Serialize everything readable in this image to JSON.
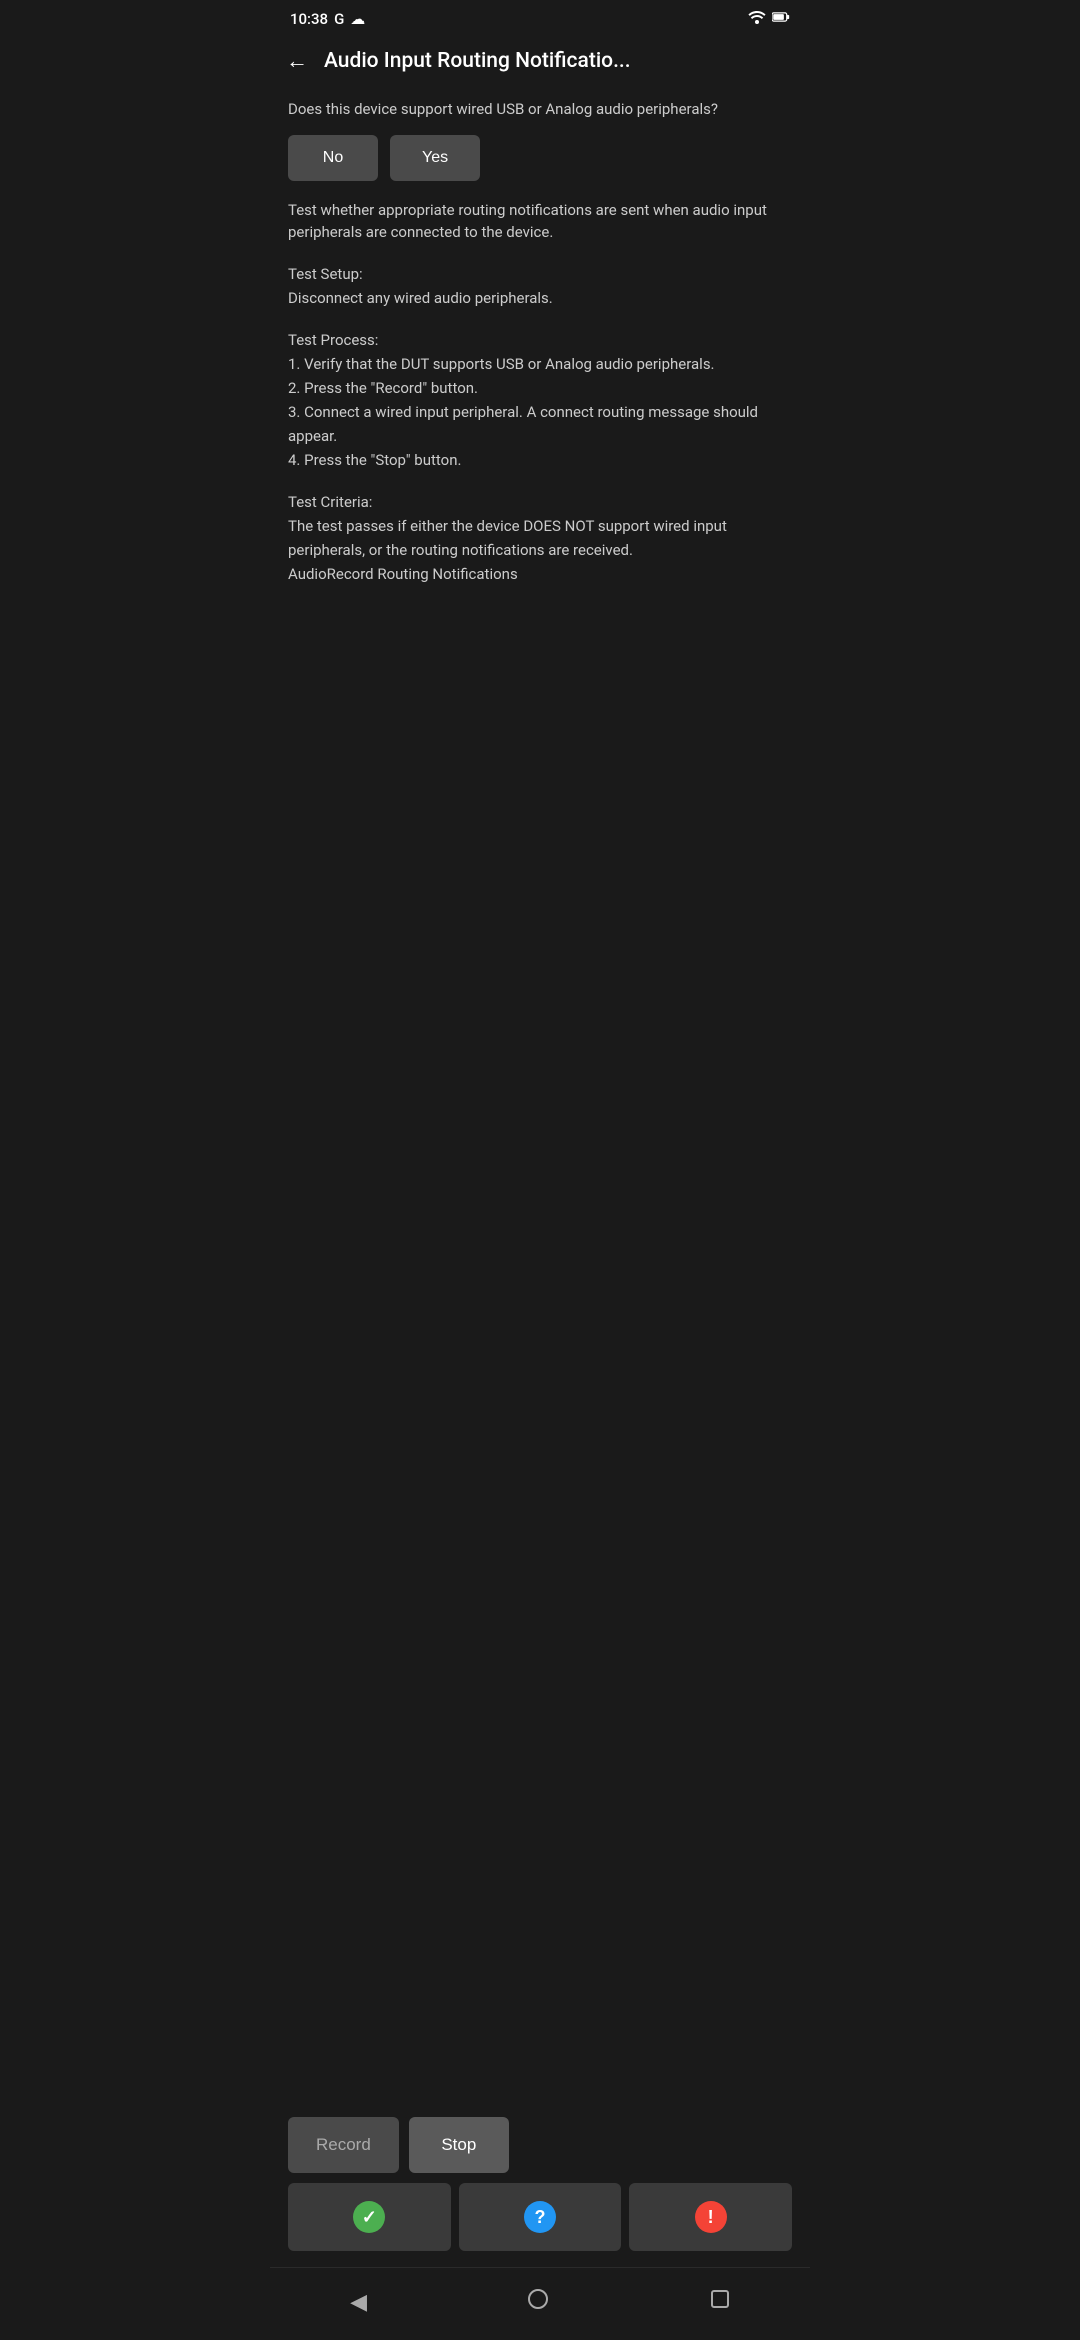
{
  "statusBar": {
    "time": "10:38",
    "googleIcon": "G",
    "cloudIcon": "☁",
    "wifiIcon": "▼",
    "batteryIcon": "▮"
  },
  "toolbar": {
    "backLabel": "←",
    "title": "Audio Input Routing Notificatio..."
  },
  "content": {
    "questionText": "Does this device support wired USB or Analog audio peripherals?",
    "noLabel": "No",
    "yesLabel": "Yes",
    "descriptionText": "Test whether appropriate routing notifications are sent when audio input peripherals are connected to the device.",
    "setupTitle": "Test Setup:",
    "setupText": "Disconnect any wired audio peripherals.",
    "processTitle": "Test Process:",
    "processText": "1. Verify that the DUT supports USB or Analog audio peripherals.\n2. Press the \"Record\" button.\n3. Connect a wired input peripheral. A connect routing message should appear.\n4. Press the \"Stop\" button.",
    "criteriaTitle": "Test Criteria:",
    "criteriaText": "The test passes if either the device DOES NOT support wired input peripherals, or the routing notifications are received.\nAudioRecord Routing Notifications"
  },
  "actions": {
    "recordLabel": "Record",
    "stopLabel": "Stop"
  },
  "results": {
    "passIcon": "✓",
    "infoIcon": "?",
    "failIcon": "!"
  },
  "navBar": {
    "backIcon": "◀",
    "homeIcon": "○",
    "recentIcon": "□"
  }
}
